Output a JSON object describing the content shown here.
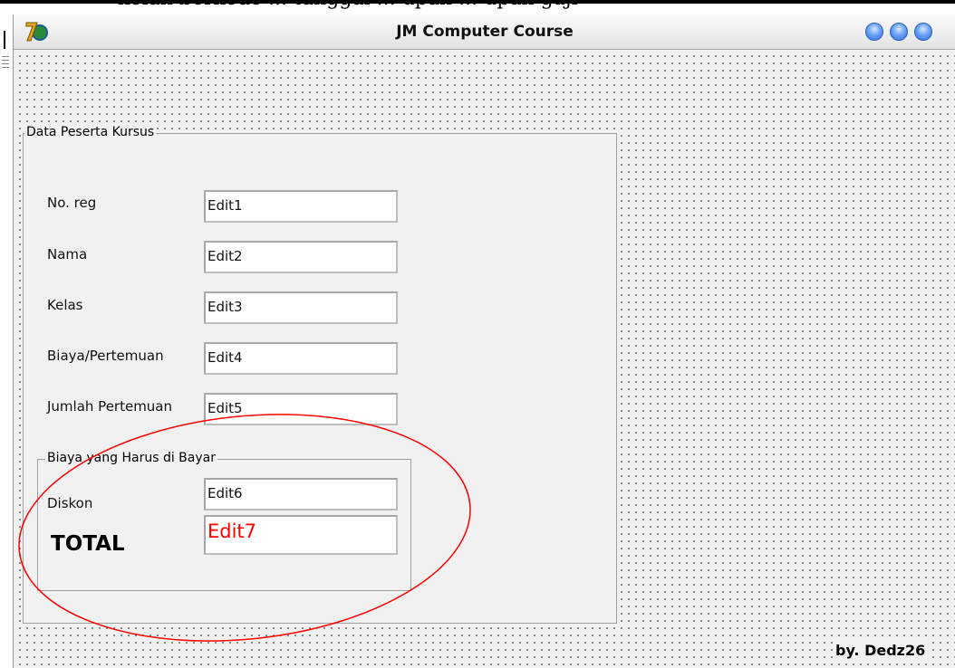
{
  "top_text": "kolah berkode ... tanggal ... upah ... upah gaji",
  "window": {
    "title": "JM Computer Course",
    "app_icon": "delphi-7-icon",
    "controls": [
      "minimize-button",
      "maximize-button",
      "close-button"
    ]
  },
  "group_main": {
    "caption": "Data Peserta Kursus",
    "fields": [
      {
        "label": "No. reg",
        "value": "Edit1"
      },
      {
        "label": "Nama",
        "value": "Edit2"
      },
      {
        "label": "Kelas",
        "value": "Edit3"
      },
      {
        "label": "Biaya/Pertemuan",
        "value": "Edit4"
      },
      {
        "label": "Jumlah Pertemuan",
        "value": "Edit5"
      }
    ]
  },
  "group_payment": {
    "caption": "Biaya yang Harus di Bayar",
    "discount_label": "Diskon",
    "discount_value": "Edit6",
    "total_label": "TOTAL",
    "total_value": "Edit7"
  },
  "footer": "by. Dedz26",
  "colors": {
    "accent_red": "#ff0000",
    "title_button_blue": "#2d6fe0",
    "form_background": "#f1f1f1"
  }
}
